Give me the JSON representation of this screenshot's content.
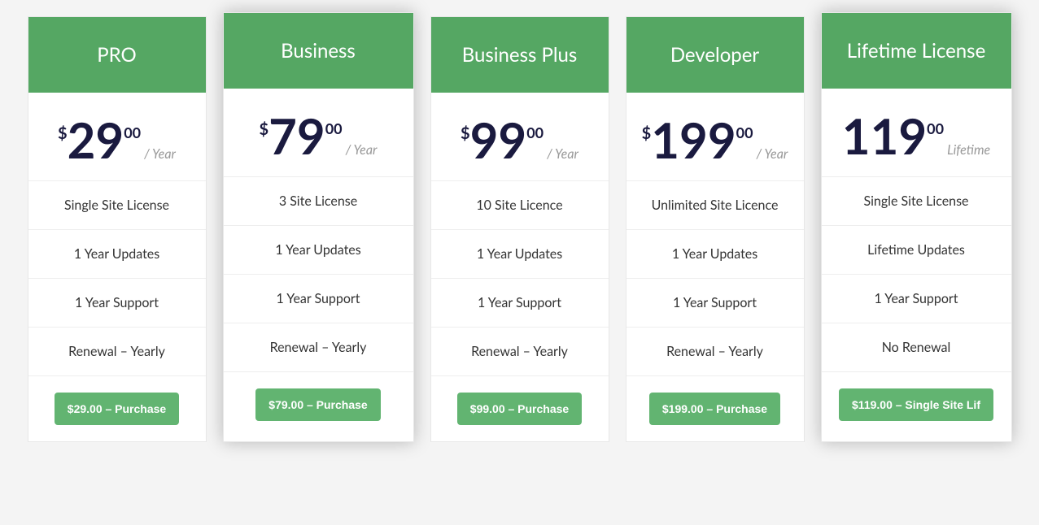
{
  "plans": [
    {
      "name": "PRO",
      "featured": false,
      "currency": "$",
      "price": "29",
      "cents": "00",
      "period": "/ Year",
      "features": [
        "Single Site License",
        "1 Year Updates",
        "1 Year Support",
        "Renewal – Yearly"
      ],
      "button": "$29.00 – Purchase"
    },
    {
      "name": "Business",
      "featured": true,
      "currency": "$",
      "price": "79",
      "cents": "00",
      "period": "/ Year",
      "features": [
        "3 Site License",
        "1 Year Updates",
        "1 Year Support",
        "Renewal – Yearly"
      ],
      "button": "$79.00 – Purchase"
    },
    {
      "name": "Business Plus",
      "featured": false,
      "currency": "$",
      "price": "99",
      "cents": "00",
      "period": "/ Year",
      "features": [
        "10 Site Licence",
        "1 Year Updates",
        "1 Year Support",
        "Renewal – Yearly"
      ],
      "button": "$99.00 – Purchase"
    },
    {
      "name": "Developer",
      "featured": false,
      "currency": "$",
      "price": "199",
      "cents": "00",
      "period": "/ Year",
      "features": [
        "Unlimited Site Licence",
        "1 Year Updates",
        "1 Year Support",
        "Renewal – Yearly"
      ],
      "button": "$199.00 – Purchase"
    },
    {
      "name": "Lifetime License",
      "featured": true,
      "currency": "",
      "price": "119",
      "cents": "00",
      "period": "Lifetime",
      "features": [
        "Single Site License",
        "Lifetime Updates",
        "1 Year Support",
        "No Renewal"
      ],
      "button": "$119.00 – Single Site Lif"
    }
  ]
}
